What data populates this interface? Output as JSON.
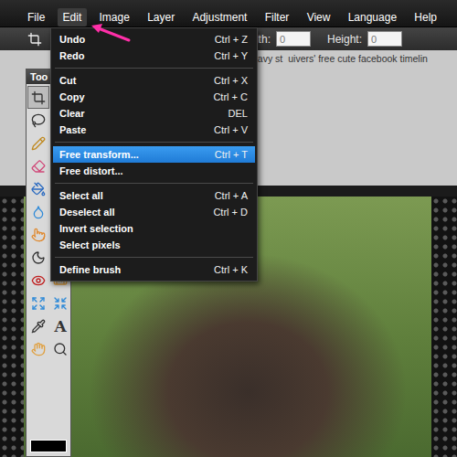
{
  "menubar": [
    {
      "label": "File",
      "selected": false
    },
    {
      "label": "Edit",
      "selected": true
    },
    {
      "label": "Image",
      "selected": false
    },
    {
      "label": "Layer",
      "selected": false
    },
    {
      "label": "Adjustment",
      "selected": false
    },
    {
      "label": "Filter",
      "selected": false
    },
    {
      "label": "View",
      "selected": false
    },
    {
      "label": "Language",
      "selected": false
    },
    {
      "label": "Help",
      "selected": false
    }
  ],
  "edit_menu": {
    "items": [
      {
        "kind": "item",
        "label": "Undo",
        "shortcut": "Ctrl + Z",
        "selected": false
      },
      {
        "kind": "item",
        "label": "Redo",
        "shortcut": "Ctrl + Y",
        "selected": false
      },
      {
        "kind": "separator"
      },
      {
        "kind": "item",
        "label": "Cut",
        "shortcut": "Ctrl + X",
        "selected": false
      },
      {
        "kind": "item",
        "label": "Copy",
        "shortcut": "Ctrl + C",
        "selected": false
      },
      {
        "kind": "item",
        "label": "Clear",
        "shortcut": "DEL",
        "selected": false
      },
      {
        "kind": "item",
        "label": "Paste",
        "shortcut": "Ctrl + V",
        "selected": false
      },
      {
        "kind": "separator"
      },
      {
        "kind": "item",
        "label": "Free transform...",
        "shortcut": "Ctrl + T",
        "selected": true
      },
      {
        "kind": "item",
        "label": "Free distort...",
        "shortcut": "",
        "selected": false
      },
      {
        "kind": "separator"
      },
      {
        "kind": "item",
        "label": "Select all",
        "shortcut": "Ctrl + A",
        "selected": false
      },
      {
        "kind": "item",
        "label": "Deselect all",
        "shortcut": "Ctrl + D",
        "selected": false
      },
      {
        "kind": "item",
        "label": "Invert selection",
        "shortcut": "",
        "selected": false
      },
      {
        "kind": "item",
        "label": "Select pixels",
        "shortcut": "",
        "selected": false
      },
      {
        "kind": "separator"
      },
      {
        "kind": "item",
        "label": "Define brush",
        "shortcut": "Ctrl + K",
        "selected": false
      }
    ]
  },
  "toolbar": {
    "width_label": "Width:",
    "width_value": "0",
    "height_label": "Height:",
    "height_value": "0"
  },
  "document": {
    "title_parts": [
      "navy st",
      "uivers' free cute facebook timelin"
    ]
  },
  "toolbox": {
    "title": "Too",
    "type_tool": "A"
  }
}
